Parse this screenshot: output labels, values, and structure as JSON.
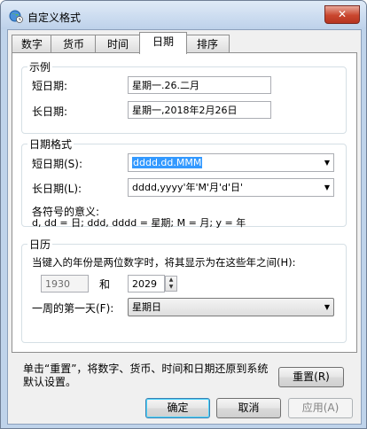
{
  "window": {
    "title": "自定义格式",
    "close_symbol": "✕"
  },
  "tabs": [
    {
      "label": "数字",
      "active": false
    },
    {
      "label": "货币",
      "active": false
    },
    {
      "label": "时间",
      "active": false
    },
    {
      "label": "日期",
      "active": true
    },
    {
      "label": "排序",
      "active": false
    }
  ],
  "example": {
    "legend": "示例",
    "short_label": "短日期:",
    "short_value": "星期一.26.二月",
    "long_label": "长日期:",
    "long_value": "星期一,2018年2月26日"
  },
  "date_format": {
    "legend": "日期格式",
    "short_label": "短日期(S):",
    "short_value": "dddd.dd.MMM",
    "long_label": "长日期(L):",
    "long_value": "dddd,yyyy'年'M'月'd'日'",
    "symbols_title": "各符号的意义:",
    "symbols_text": "d, dd = 日;  ddd, dddd = 星期;  M = 月;  y = 年"
  },
  "calendar": {
    "legend": "日历",
    "two_digit_text": "当键入的年份是两位数字时，将其显示为在这些年之间(H):",
    "year_from": "1930",
    "and_label": "和",
    "year_to": "2029",
    "first_day_label": "一周的第一天(F):",
    "first_day_value": "星期日"
  },
  "footer": {
    "reset_text": "单击“重置”，将数字、货币、时间和日期还原到系统默认设置。",
    "reset_button": "重置(R)",
    "ok_button": "确定",
    "cancel_button": "取消",
    "apply_button": "应用(A)"
  },
  "icons": {
    "app": "globe-clock-icon",
    "dropdown": "chevron-down-icon",
    "spin_up": "spin-up-icon",
    "spin_down": "spin-down-icon"
  },
  "colors": {
    "selection": "#3399ff",
    "title_bar": "#bdd1ea",
    "close_button": "#c9462e"
  }
}
